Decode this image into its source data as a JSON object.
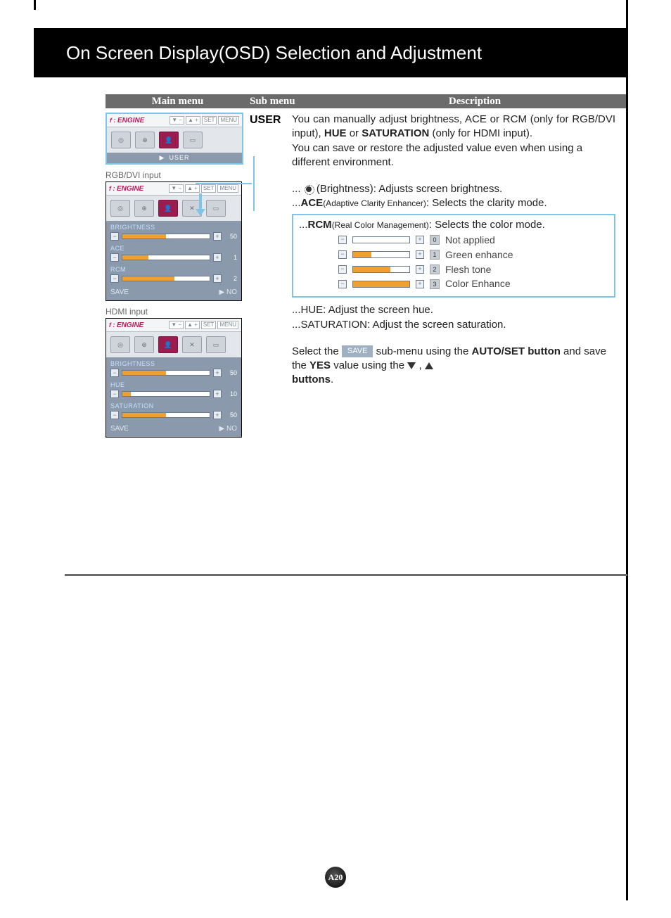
{
  "page": {
    "title": "On Screen Display(OSD) Selection and Adjustment",
    "number": "A20"
  },
  "headers": {
    "main_menu": "Main menu",
    "sub_menu": "Sub menu",
    "description": "Description"
  },
  "sub_menu": "USER",
  "captions": {
    "rgb_dvi": "RGB/DVI input",
    "hdmi": "HDMI input"
  },
  "osd": {
    "engine_label": "ENGINE",
    "nav": {
      "set": "SET",
      "menu": "MENU"
    },
    "user_label": "USER",
    "panel1": {
      "items": [
        {
          "label": "BRIGHTNESS",
          "value": "50",
          "fill": 50
        },
        {
          "label": "ACE",
          "value": "1",
          "fill": 30
        },
        {
          "label": "RCM",
          "value": "2",
          "fill": 60
        }
      ],
      "save": "SAVE",
      "save_val": "▶ NO"
    },
    "panel2": {
      "items": [
        {
          "label": "BRIGHTNESS",
          "value": "50",
          "fill": 50
        },
        {
          "label": "HUE",
          "value": "10",
          "fill": 10
        },
        {
          "label": "SATURATION",
          "value": "50",
          "fill": 50
        }
      ],
      "save": "SAVE",
      "save_val": "▶ NO"
    }
  },
  "desc": {
    "p1a": "You can manually adjust brightness, ACE or RCM (only for RGB/DVI input), ",
    "p1b": "HUE",
    "p1c": " or ",
    "p1d": "SATURATION",
    "p1e": " (only for HDMI input).",
    "p2": "You can save or restore the adjusted value even when using a different environment.",
    "brightness": " (Brightness): Adjusts screen brightness.",
    "ace_pre": "ACE",
    "ace_mid": "(Adaptive Clarity Enhancer)",
    "ace_post": ": Selects the clarity mode.",
    "rcm_pre": "RCM",
    "rcm_mid": "(Real Color Management)",
    "rcm_post": ": Selects the color mode.",
    "hue": "...HUE: Adjust the screen hue.",
    "sat": "...SATURATION: Adjust the screen saturation.",
    "sel1": "Select the ",
    "save_badge": "SAVE",
    "sel2": " sub-menu using the ",
    "sel3": "AUTO/SET button",
    "sel4": " and save the ",
    "sel5": "YES",
    "sel6": " value using the ",
    "sel7": "buttons",
    "dots": "..."
  },
  "chart_data": {
    "type": "table",
    "title": "RCM (Real Color Management) modes",
    "columns": [
      "value",
      "label"
    ],
    "rows": [
      {
        "value": 0,
        "label": "Not applied"
      },
      {
        "value": 1,
        "label": "Green enhance"
      },
      {
        "value": 2,
        "label": "Flesh tone"
      },
      {
        "value": 3,
        "label": "Color Enhance"
      }
    ]
  }
}
